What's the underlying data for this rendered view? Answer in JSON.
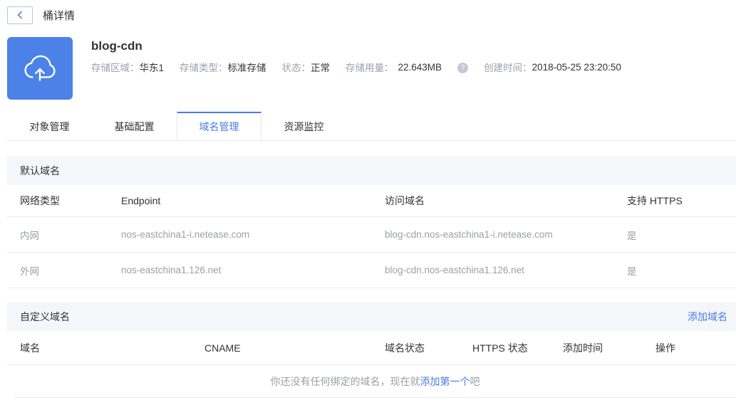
{
  "header": {
    "title": "桶详情"
  },
  "bucket": {
    "name": "blog-cdn",
    "meta": [
      {
        "label": "存储区域：",
        "value": "华东1"
      },
      {
        "label": "存储类型：",
        "value": "标准存储"
      },
      {
        "label": "状态：",
        "value": "正常"
      },
      {
        "label": "存储用量：",
        "value": "22.643MB"
      },
      {
        "label": "创建时间：",
        "value": "2018-05-25 23:20:50"
      }
    ],
    "help_icon": "?"
  },
  "tabs": [
    {
      "label": "对象管理",
      "active": false
    },
    {
      "label": "基础配置",
      "active": false
    },
    {
      "label": "域名管理",
      "active": true
    },
    {
      "label": "资源监控",
      "active": false
    }
  ],
  "default_domains": {
    "section_title": "默认域名",
    "columns": [
      "网络类型",
      "Endpoint",
      "访问域名",
      "支持 HTTPS"
    ],
    "rows": [
      [
        "内网",
        "nos-eastchina1-i.netease.com",
        "blog-cdn.nos-eastchina1-i.netease.com",
        "是"
      ],
      [
        "外网",
        "nos-eastchina1.126.net",
        "blog-cdn.nos-eastchina1.126.net",
        "是"
      ]
    ]
  },
  "custom_domains": {
    "section_title": "自定义域名",
    "add_link_label": "添加域名",
    "columns": [
      "域名",
      "CNAME",
      "域名状态",
      "HTTPS 状态",
      "添加时间",
      "操作"
    ],
    "empty_state": {
      "prefix": "你还没有任何绑定的域名，现在就",
      "link": "添加第一个",
      "suffix": "吧"
    }
  },
  "colors": {
    "accent_blue": "#4b7be2",
    "icon_background": "#4c82e8",
    "section_header_background": "#f5f6fa",
    "muted_text": "#9b9fa8"
  }
}
